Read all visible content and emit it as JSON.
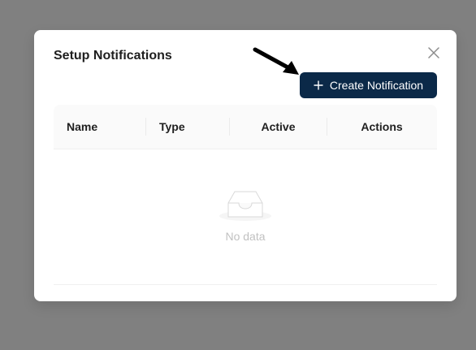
{
  "modal": {
    "title": "Setup Notifications",
    "create_button_label": "Create Notification"
  },
  "table": {
    "columns": [
      "Name",
      "Type",
      "Active",
      "Actions"
    ],
    "rows": [],
    "empty_text": "No data"
  },
  "icons": {
    "close": "close-icon",
    "plus": "plus-icon",
    "empty": "empty-inbox-icon",
    "annotation": "arrow-icon"
  },
  "colors": {
    "primary": "#0b2948",
    "backdrop": "#808080"
  }
}
